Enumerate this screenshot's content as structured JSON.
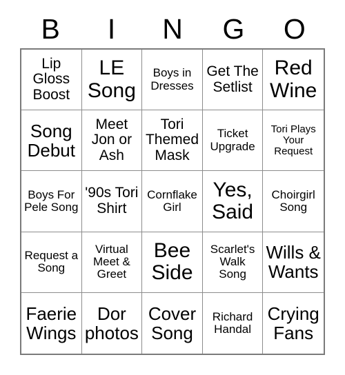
{
  "card": {
    "title": "BINGO",
    "header_letters": [
      "B",
      "I",
      "N",
      "G",
      "O"
    ],
    "rows": 5,
    "columns": 5,
    "grid_line_color": "#8c8c8c",
    "border_color": "#7a7a7a",
    "background_color": "#ffffff",
    "text_color": "#000000"
  },
  "cells": [
    {
      "text": "Lip Gloss Boost",
      "column": "B",
      "row": 1,
      "size": "s-md",
      "marked": false
    },
    {
      "text": "LE Song",
      "column": "I",
      "row": 1,
      "size": "s-xl",
      "marked": false
    },
    {
      "text": "Boys in Dresses",
      "column": "N",
      "row": 1,
      "size": "s-sm",
      "marked": false
    },
    {
      "text": "Get The Setlist",
      "column": "G",
      "row": 1,
      "size": "s-md",
      "marked": false
    },
    {
      "text": "Red Wine",
      "column": "O",
      "row": 1,
      "size": "s-xl",
      "marked": false
    },
    {
      "text": "Song Debut",
      "column": "B",
      "row": 2,
      "size": "s-lg",
      "marked": false
    },
    {
      "text": "Meet Jon or Ash",
      "column": "I",
      "row": 2,
      "size": "s-md",
      "marked": false
    },
    {
      "text": "Tori Themed Mask",
      "column": "N",
      "row": 2,
      "size": "s-md",
      "marked": false
    },
    {
      "text": "Ticket Upgrade",
      "column": "G",
      "row": 2,
      "size": "s-sm",
      "marked": false
    },
    {
      "text": "Tori Plays Your Request",
      "column": "O",
      "row": 2,
      "size": "s-xs",
      "marked": false
    },
    {
      "text": "Boys For Pele Song",
      "column": "B",
      "row": 3,
      "size": "s-sm",
      "marked": false
    },
    {
      "text": "'90s Tori Shirt",
      "column": "I",
      "row": 3,
      "size": "s-md",
      "marked": false
    },
    {
      "text": "Cornflake Girl",
      "column": "N",
      "row": 3,
      "size": "s-sm",
      "marked": false
    },
    {
      "text": "Yes, Said",
      "column": "G",
      "row": 3,
      "size": "s-xl",
      "marked": false
    },
    {
      "text": "Choirgirl Song",
      "column": "O",
      "row": 3,
      "size": "s-sm",
      "marked": false
    },
    {
      "text": "Request a Song",
      "column": "B",
      "row": 4,
      "size": "s-sm",
      "marked": false
    },
    {
      "text": "Virtual Meet & Greet",
      "column": "I",
      "row": 4,
      "size": "s-sm",
      "marked": false
    },
    {
      "text": "Bee Side",
      "column": "N",
      "row": 4,
      "size": "s-xl",
      "marked": false
    },
    {
      "text": "Scarlet's Walk Song",
      "column": "G",
      "row": 4,
      "size": "s-sm",
      "marked": false
    },
    {
      "text": "Wills & Wants",
      "column": "O",
      "row": 4,
      "size": "s-lg",
      "marked": false
    },
    {
      "text": "Faerie Wings",
      "column": "B",
      "row": 5,
      "size": "s-lg",
      "marked": false
    },
    {
      "text": "Dor photos",
      "column": "I",
      "row": 5,
      "size": "s-lg",
      "marked": false
    },
    {
      "text": "Cover Song",
      "column": "N",
      "row": 5,
      "size": "s-lg",
      "marked": false
    },
    {
      "text": "Richard Handal",
      "column": "G",
      "row": 5,
      "size": "s-sm",
      "marked": false
    },
    {
      "text": "Crying Fans",
      "column": "O",
      "row": 5,
      "size": "s-lg",
      "marked": false
    }
  ]
}
